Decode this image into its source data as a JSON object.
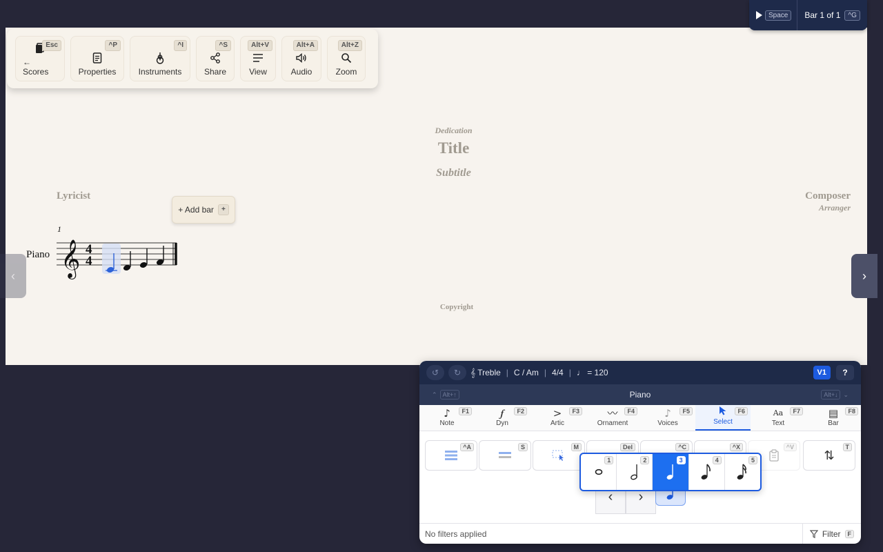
{
  "playback": {
    "shortcut": "Space",
    "bar_label": "Bar 1 of 1",
    "bar_shortcut": "^G"
  },
  "menu": [
    {
      "label": "← Scores",
      "shortcut": "Esc",
      "icon": "book-icon"
    },
    {
      "label": "Properties",
      "shortcut": "^P",
      "icon": "document-icon"
    },
    {
      "label": "Instruments",
      "shortcut": "^I",
      "icon": "guitar-icon"
    },
    {
      "label": "Share",
      "shortcut": "^S",
      "icon": "share-icon"
    },
    {
      "label": "View",
      "shortcut": "Alt+V",
      "icon": "lines-icon"
    },
    {
      "label": "Audio",
      "shortcut": "Alt+A",
      "icon": "speaker-icon"
    },
    {
      "label": "Zoom",
      "shortcut": "Alt+Z",
      "icon": "search-icon"
    }
  ],
  "score": {
    "dedication": "Dedication",
    "title": "Title",
    "subtitle": "Subtitle",
    "lyricist": "Lyricist",
    "composer": "Composer",
    "arranger": "Arranger",
    "copyright": "Copyright",
    "instrument": "Piano",
    "bar_number": "1",
    "add_bar": "+ Add bar",
    "add_bar_shortcut": "+"
  },
  "panel": {
    "clef": "𝄞 Treble",
    "key": "C / Am",
    "time": "4/4",
    "tempo": "♩ = 120",
    "voice": "V1",
    "help": "?",
    "instrument": "Piano",
    "prev_shortcut": "Alt+↑",
    "next_shortcut": "Alt+↓",
    "tabs": [
      {
        "label": "Note",
        "shortcut": "F1",
        "glyph": "♪"
      },
      {
        "label": "Dyn",
        "shortcut": "F2",
        "glyph": "𝆑"
      },
      {
        "label": "Artic",
        "shortcut": "F3",
        "glyph": ">"
      },
      {
        "label": "Ornament",
        "shortcut": "F4",
        "glyph": "〰"
      },
      {
        "label": "Voices",
        "shortcut": "F5",
        "glyph": "♪"
      },
      {
        "label": "Select",
        "shortcut": "F6",
        "glyph": "➤"
      },
      {
        "label": "Text",
        "shortcut": "F7",
        "glyph": "Aa"
      },
      {
        "label": "Bar",
        "shortcut": "F8",
        "glyph": "▤"
      }
    ],
    "tools": [
      {
        "shortcut": "^A"
      },
      {
        "shortcut": "S"
      },
      {
        "shortcut": "M"
      },
      {
        "shortcut": "Del"
      },
      {
        "shortcut": "^C"
      },
      {
        "shortcut": "^X"
      },
      {
        "shortcut": "^V"
      },
      {
        "shortcut": "T"
      }
    ],
    "filter_status": "No filters applied",
    "filter_label": "Filter",
    "filter_shortcut": "F"
  },
  "durations": [
    {
      "shortcut": "1",
      "name": "whole"
    },
    {
      "shortcut": "2",
      "name": "half"
    },
    {
      "shortcut": "3",
      "name": "quarter"
    },
    {
      "shortcut": "4",
      "name": "eighth"
    },
    {
      "shortcut": "5",
      "name": "sixteenth"
    }
  ],
  "colors": {
    "accent": "#1d5be0",
    "paper": "#f7f3ee",
    "dark": "#1e2a48"
  }
}
